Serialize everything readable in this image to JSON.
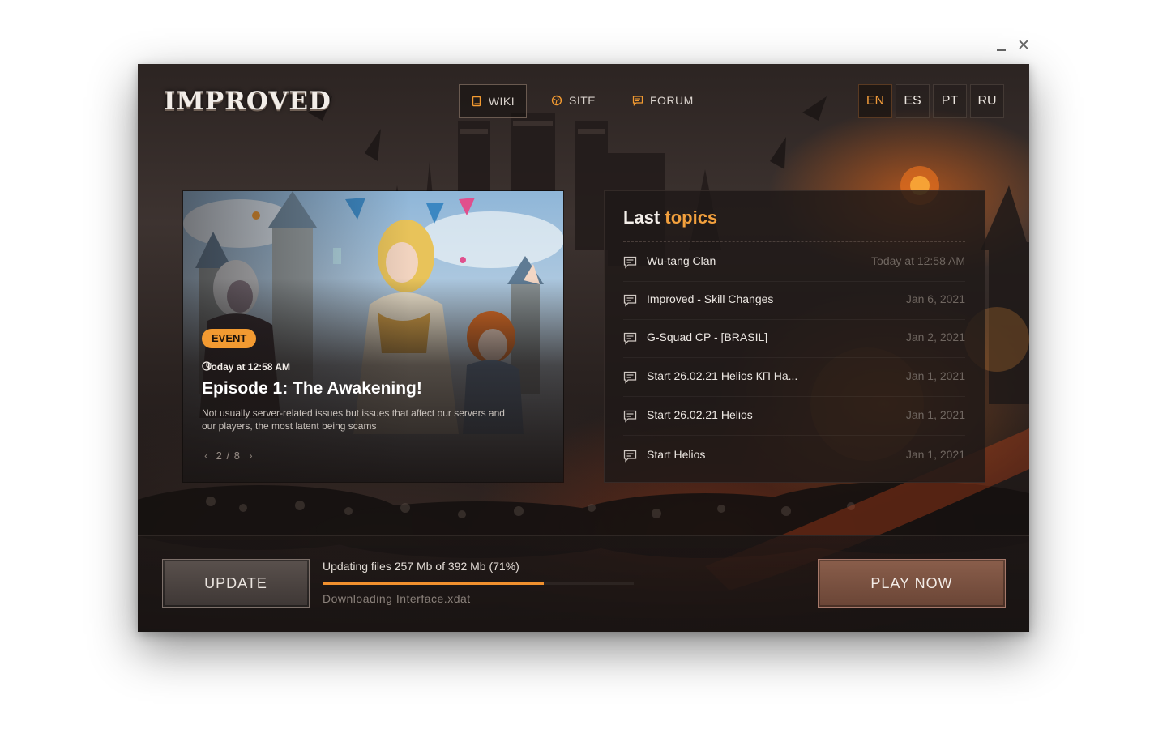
{
  "window": {
    "minimize_icon": "minimize-icon",
    "close_icon": "close-icon",
    "close_glyph": "✕"
  },
  "brand": {
    "logo_text": "IMPROVED"
  },
  "nav": {
    "items": [
      {
        "label": "WIKI",
        "icon": "book-icon",
        "active": true
      },
      {
        "label": "SITE",
        "icon": "globe-icon",
        "active": false
      },
      {
        "label": "FORUM",
        "icon": "chat-icon",
        "active": false
      }
    ]
  },
  "languages": [
    {
      "code": "EN",
      "active": true
    },
    {
      "code": "ES",
      "active": false
    },
    {
      "code": "PT",
      "active": false
    },
    {
      "code": "RU",
      "active": false
    }
  ],
  "feature": {
    "badge": "EVENT",
    "time": "Today at 12:58 AM",
    "title": "Episode 1: The Awakening!",
    "description": "Not usually server-related issues but issues that affect our servers and our players, the most latent being scams",
    "pager": "2 / 8",
    "prev_glyph": "‹",
    "next_glyph": "›"
  },
  "topics": {
    "title_main": "Last",
    "title_accent": "topics",
    "items": [
      {
        "name": "Wu-tang Clan",
        "date": "Today at 12:58 AM"
      },
      {
        "name": "Improved - Skill Changes",
        "date": "Jan 6, 2021"
      },
      {
        "name": "G-Squad CP - [BRASIL]",
        "date": "Jan 2, 2021"
      },
      {
        "name": "Start 26.02.21 Helios КП Ha...",
        "date": "Jan 1, 2021"
      },
      {
        "name": "Start 26.02.21 Helios",
        "date": "Jan 1, 2021"
      },
      {
        "name": "Start Helios",
        "date": "Jan 1, 2021"
      }
    ]
  },
  "footer": {
    "update_label": "UPDATE",
    "status": "Updating files 257 Mb of 392 Mb (71%)",
    "progress": 0.71,
    "download_text": "Downloading Interface.xdat",
    "play_label": "PLAY NOW"
  },
  "colors": {
    "accent": "#f29a31",
    "panel": "#1e1817",
    "text": "#ece7e2",
    "muted": "#6f6660"
  }
}
